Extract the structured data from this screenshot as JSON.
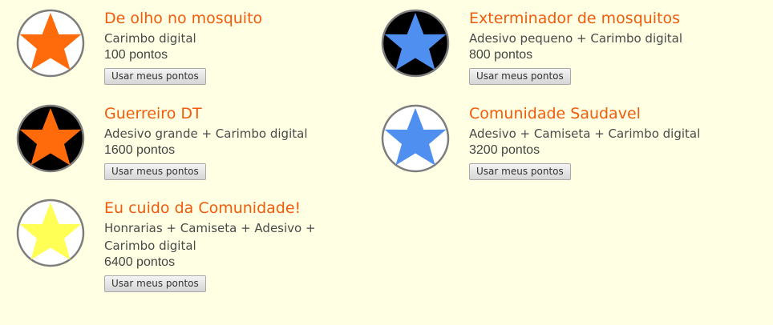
{
  "rewards": [
    {
      "title": "De olho no mosquito",
      "description": "Carimbo digital",
      "points": "100 pontos",
      "button_label": "Usar meus pontos",
      "badge": {
        "icon": "star-icon",
        "star_color": "#ff6a0a",
        "background": "#ffffff"
      }
    },
    {
      "title": "Exterminador de mosquitos",
      "description": "Adesivo pequeno + Carimbo digital",
      "points": "800 pontos",
      "button_label": "Usar meus pontos",
      "badge": {
        "icon": "star-icon",
        "star_color": "#4f8ff0",
        "background": "#000000"
      }
    },
    {
      "title": "Guerreiro DT",
      "description": "Adesivo grande + Carimbo digital",
      "points": "1600 pontos",
      "button_label": "Usar meus pontos",
      "badge": {
        "icon": "star-icon",
        "star_color": "#ff6a0a",
        "background": "#000000"
      }
    },
    {
      "title": "Comunidade Saudavel",
      "description": "Adesivo + Camiseta + Carimbo digital",
      "points": "3200 pontos",
      "button_label": "Usar meus pontos",
      "badge": {
        "icon": "star-icon",
        "star_color": "#4f8ff0",
        "background": "#ffffff"
      }
    },
    {
      "title": "Eu cuido da Comunidade!",
      "description": "Honrarias + Camiseta + Adesivo + Carimbo digital",
      "points": "6400 pontos",
      "button_label": "Usar meus pontos",
      "badge": {
        "icon": "star-icon",
        "star_color": "#ffff55",
        "background": "#ffffff"
      }
    }
  ]
}
